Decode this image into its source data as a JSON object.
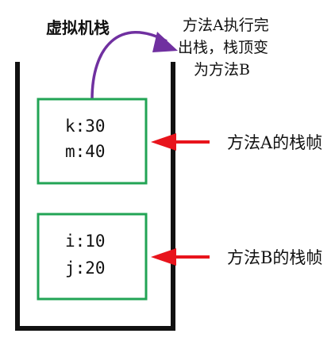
{
  "title": "虚拟机栈",
  "note_lines": [
    "方法A执行完",
    "出栈，栈顶变",
    "为方法B"
  ],
  "frames": [
    {
      "lines": [
        "k:30",
        "m:40"
      ],
      "pointer_label": "方法A的栈帧"
    },
    {
      "lines": [
        "i:10",
        "j:20"
      ],
      "pointer_label": "方法B的栈帧"
    }
  ],
  "colors": {
    "stack_outline": "#111111",
    "frame_border": "#22a455",
    "pointer_arrow": "#e8141c",
    "pop_arrow": "#7030a0"
  }
}
